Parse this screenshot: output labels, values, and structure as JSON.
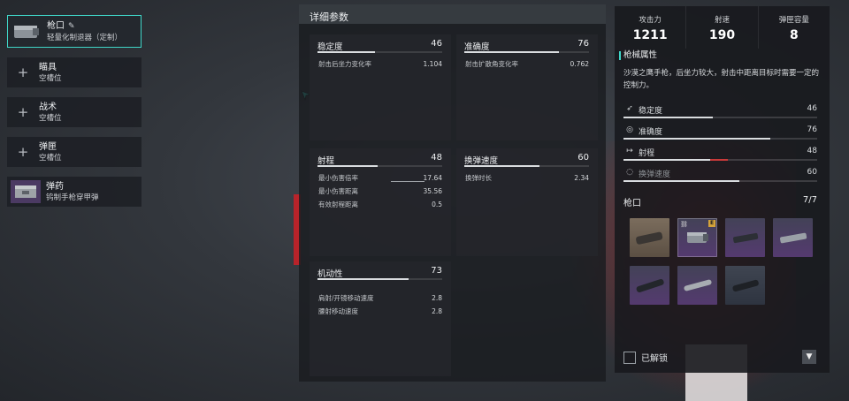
{
  "colors": {
    "accent": "#3fd6c8",
    "purple_rarity": "#543a6f",
    "orange_rarity": "#7b6d5d",
    "badge": "#d3a23a"
  },
  "left_slots": [
    {
      "title": "枪口",
      "sub": "轻量化制退器（定制）",
      "icon": "muzzle-brake-icon",
      "active": true
    },
    {
      "title": "瞄具",
      "sub": "空槽位",
      "icon": "plus-icon"
    },
    {
      "title": "战术",
      "sub": "空槽位",
      "icon": "plus-icon"
    },
    {
      "title": "弹匣",
      "sub": "空槽位",
      "icon": "plus-icon"
    },
    {
      "title": "弹药",
      "sub": "钨制手枪穿甲弹",
      "icon": "ammo-box-icon"
    }
  ],
  "center": {
    "title": "详细参数",
    "cards": [
      {
        "name": "稳定度",
        "value": "46",
        "level": 46,
        "rows": [
          {
            "label": "射击后坐力变化率",
            "value": "1.104"
          }
        ]
      },
      {
        "name": "准确度",
        "value": "76",
        "level": 76,
        "rows": [
          {
            "label": "射击扩散角变化率",
            "value": "0.762"
          }
        ]
      },
      {
        "name": "射程",
        "value": "48",
        "level": 48,
        "rows": [
          {
            "label": "最小伤害倍率",
            "value": "17.64"
          },
          {
            "label": "最小伤害距离",
            "value": "35.56"
          },
          {
            "label": "有效射程距离",
            "value": "0.5"
          }
        ]
      },
      {
        "name": "换弹速度",
        "value": "60",
        "level": 60,
        "rows": [
          {
            "label": "换弹时长",
            "value": "2.34"
          }
        ]
      },
      {
        "name": "机动性",
        "value": "73",
        "level": 73,
        "rows": [
          {
            "label": "肩射/开镜移动速度",
            "value": "2.8"
          },
          {
            "label": "腰射移动速度",
            "value": "2.8"
          }
        ]
      }
    ]
  },
  "right": {
    "stats": [
      {
        "label": "攻击力",
        "value": "1211"
      },
      {
        "label": "射速",
        "value": "190"
      },
      {
        "label": "弹匣容量",
        "value": "8"
      }
    ],
    "section_title": "枪械属性",
    "description": "沙漠之鹰手枪，后坐力较大，射击中距离目标时需要一定的控制力。",
    "attributes": [
      {
        "label": "稳定度",
        "value": "46",
        "level": 46,
        "icon": "recoil-icon"
      },
      {
        "label": "准确度",
        "value": "76",
        "level": 76,
        "icon": "crosshair-icon"
      },
      {
        "label": "射程",
        "value": "48",
        "level": 48,
        "icon": "range-arrow-icon"
      },
      {
        "label": "换弹速度",
        "value": "60",
        "level": 60,
        "icon": "reload-icon"
      }
    ],
    "muzzle_title": "枪口",
    "muzzle_count": "7/7",
    "unlock_label": "已解锁",
    "badge_text": "E"
  }
}
